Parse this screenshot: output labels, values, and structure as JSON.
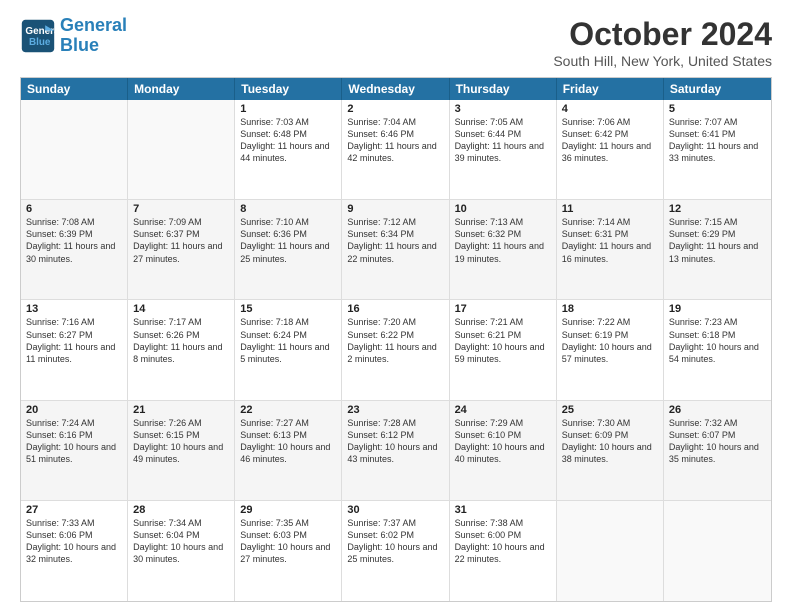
{
  "header": {
    "logo_line1": "General",
    "logo_line2": "Blue",
    "title": "October 2024",
    "location": "South Hill, New York, United States"
  },
  "weekdays": [
    "Sunday",
    "Monday",
    "Tuesday",
    "Wednesday",
    "Thursday",
    "Friday",
    "Saturday"
  ],
  "weeks": [
    [
      {
        "day": "",
        "info": "",
        "empty": true
      },
      {
        "day": "",
        "info": "",
        "empty": true
      },
      {
        "day": "1",
        "info": "Sunrise: 7:03 AM\nSunset: 6:48 PM\nDaylight: 11 hours and 44 minutes."
      },
      {
        "day": "2",
        "info": "Sunrise: 7:04 AM\nSunset: 6:46 PM\nDaylight: 11 hours and 42 minutes."
      },
      {
        "day": "3",
        "info": "Sunrise: 7:05 AM\nSunset: 6:44 PM\nDaylight: 11 hours and 39 minutes."
      },
      {
        "day": "4",
        "info": "Sunrise: 7:06 AM\nSunset: 6:42 PM\nDaylight: 11 hours and 36 minutes."
      },
      {
        "day": "5",
        "info": "Sunrise: 7:07 AM\nSunset: 6:41 PM\nDaylight: 11 hours and 33 minutes."
      }
    ],
    [
      {
        "day": "6",
        "info": "Sunrise: 7:08 AM\nSunset: 6:39 PM\nDaylight: 11 hours and 30 minutes."
      },
      {
        "day": "7",
        "info": "Sunrise: 7:09 AM\nSunset: 6:37 PM\nDaylight: 11 hours and 27 minutes."
      },
      {
        "day": "8",
        "info": "Sunrise: 7:10 AM\nSunset: 6:36 PM\nDaylight: 11 hours and 25 minutes."
      },
      {
        "day": "9",
        "info": "Sunrise: 7:12 AM\nSunset: 6:34 PM\nDaylight: 11 hours and 22 minutes."
      },
      {
        "day": "10",
        "info": "Sunrise: 7:13 AM\nSunset: 6:32 PM\nDaylight: 11 hours and 19 minutes."
      },
      {
        "day": "11",
        "info": "Sunrise: 7:14 AM\nSunset: 6:31 PM\nDaylight: 11 hours and 16 minutes."
      },
      {
        "day": "12",
        "info": "Sunrise: 7:15 AM\nSunset: 6:29 PM\nDaylight: 11 hours and 13 minutes."
      }
    ],
    [
      {
        "day": "13",
        "info": "Sunrise: 7:16 AM\nSunset: 6:27 PM\nDaylight: 11 hours and 11 minutes."
      },
      {
        "day": "14",
        "info": "Sunrise: 7:17 AM\nSunset: 6:26 PM\nDaylight: 11 hours and 8 minutes."
      },
      {
        "day": "15",
        "info": "Sunrise: 7:18 AM\nSunset: 6:24 PM\nDaylight: 11 hours and 5 minutes."
      },
      {
        "day": "16",
        "info": "Sunrise: 7:20 AM\nSunset: 6:22 PM\nDaylight: 11 hours and 2 minutes."
      },
      {
        "day": "17",
        "info": "Sunrise: 7:21 AM\nSunset: 6:21 PM\nDaylight: 10 hours and 59 minutes."
      },
      {
        "day": "18",
        "info": "Sunrise: 7:22 AM\nSunset: 6:19 PM\nDaylight: 10 hours and 57 minutes."
      },
      {
        "day": "19",
        "info": "Sunrise: 7:23 AM\nSunset: 6:18 PM\nDaylight: 10 hours and 54 minutes."
      }
    ],
    [
      {
        "day": "20",
        "info": "Sunrise: 7:24 AM\nSunset: 6:16 PM\nDaylight: 10 hours and 51 minutes."
      },
      {
        "day": "21",
        "info": "Sunrise: 7:26 AM\nSunset: 6:15 PM\nDaylight: 10 hours and 49 minutes."
      },
      {
        "day": "22",
        "info": "Sunrise: 7:27 AM\nSunset: 6:13 PM\nDaylight: 10 hours and 46 minutes."
      },
      {
        "day": "23",
        "info": "Sunrise: 7:28 AM\nSunset: 6:12 PM\nDaylight: 10 hours and 43 minutes."
      },
      {
        "day": "24",
        "info": "Sunrise: 7:29 AM\nSunset: 6:10 PM\nDaylight: 10 hours and 40 minutes."
      },
      {
        "day": "25",
        "info": "Sunrise: 7:30 AM\nSunset: 6:09 PM\nDaylight: 10 hours and 38 minutes."
      },
      {
        "day": "26",
        "info": "Sunrise: 7:32 AM\nSunset: 6:07 PM\nDaylight: 10 hours and 35 minutes."
      }
    ],
    [
      {
        "day": "27",
        "info": "Sunrise: 7:33 AM\nSunset: 6:06 PM\nDaylight: 10 hours and 32 minutes."
      },
      {
        "day": "28",
        "info": "Sunrise: 7:34 AM\nSunset: 6:04 PM\nDaylight: 10 hours and 30 minutes."
      },
      {
        "day": "29",
        "info": "Sunrise: 7:35 AM\nSunset: 6:03 PM\nDaylight: 10 hours and 27 minutes."
      },
      {
        "day": "30",
        "info": "Sunrise: 7:37 AM\nSunset: 6:02 PM\nDaylight: 10 hours and 25 minutes."
      },
      {
        "day": "31",
        "info": "Sunrise: 7:38 AM\nSunset: 6:00 PM\nDaylight: 10 hours and 22 minutes."
      },
      {
        "day": "",
        "info": "",
        "empty": true
      },
      {
        "day": "",
        "info": "",
        "empty": true
      }
    ]
  ]
}
